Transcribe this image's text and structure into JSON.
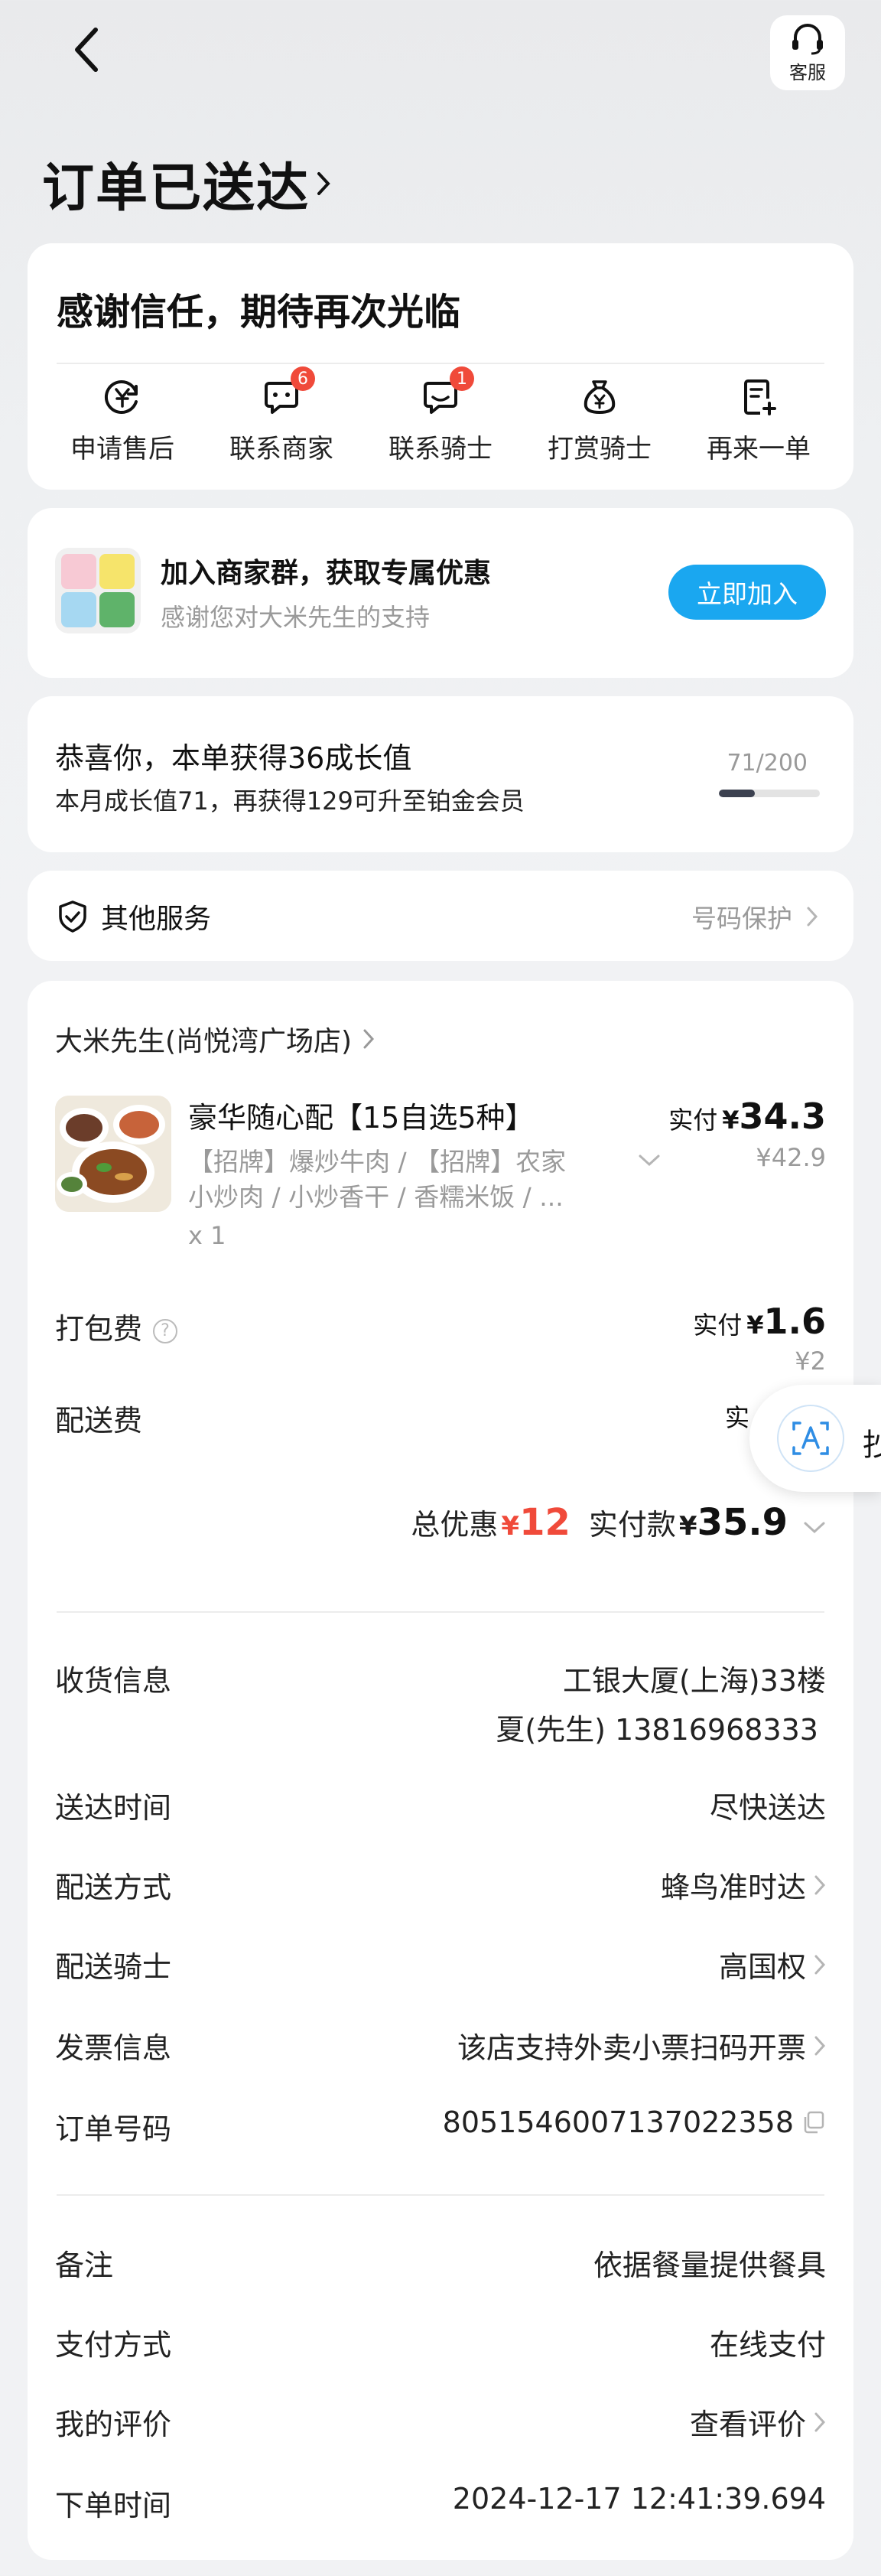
{
  "header": {
    "service_label": "客服",
    "status_title": "订单已送达"
  },
  "thanks_card": {
    "title": "感谢信任，期待再次光临",
    "actions": [
      {
        "label": "申请售后",
        "icon": "yen-circle-icon",
        "badge": ""
      },
      {
        "label": "联系商家",
        "icon": "chat-bubble-icon",
        "badge": "6"
      },
      {
        "label": "联系骑士",
        "icon": "chat-bubble-icon",
        "badge": "1"
      },
      {
        "label": "打赏骑士",
        "icon": "money-bag-icon",
        "badge": ""
      },
      {
        "label": "再来一单",
        "icon": "reorder-icon",
        "badge": ""
      }
    ]
  },
  "group_card": {
    "title": "加入商家群，获取专属优惠",
    "subtitle": "感谢您对大米先生的支持",
    "join_label": "立即加入"
  },
  "growth_card": {
    "title": "恭喜你，本单获得36成长值",
    "subtitle": "本月成长值71，再获得129可升至铂金会员",
    "progress_text": "71/200",
    "progress_fraction": 0.355
  },
  "service_card": {
    "title": "其他服务",
    "right_label": "号码保护"
  },
  "order_card": {
    "shop_name": "大米先生(尚悦湾广场店)",
    "item": {
      "title": "豪华随心配【15自选5种】",
      "spec_line1": "【招牌】爆炒牛肉 / 【招牌】农家",
      "spec_line2": "小炒肉 / 小炒香干 / 香糯米饭 / ...",
      "qty": "x 1",
      "paid_label": "实付",
      "paid_yen": "¥",
      "paid_value": "34.3",
      "original": "¥42.9"
    },
    "packing": {
      "label": "打包费",
      "paid_label": "实付",
      "paid_yen": "¥",
      "paid_value": "1.6",
      "original": "¥2"
    },
    "delivery_fee": {
      "label": "配送费",
      "paid_partial": "实"
    },
    "totals": {
      "discount_label": "总优惠",
      "discount_yen": "¥",
      "discount_value": "12",
      "paid_label": "实付款",
      "paid_yen": "¥",
      "paid_value": "35.9"
    },
    "info": [
      {
        "label": "收货信息",
        "value": "工银大厦(上海)33楼",
        "value2": "夏(先生) 13816968333"
      },
      {
        "label": "送达时间",
        "value": "尽快送达"
      },
      {
        "label": "配送方式",
        "value": "蜂鸟准时达"
      },
      {
        "label": "配送骑士",
        "value": "高国权"
      },
      {
        "label": "发票信息",
        "value": "该店支持外卖小票扫码开票"
      },
      {
        "label": "订单号码",
        "value": "8051546007137022358"
      },
      {
        "label": "备注",
        "value": "依据餐量提供餐具"
      },
      {
        "label": "支付方式",
        "value": "在线支付"
      },
      {
        "label": "我的评价",
        "value": "查看评价"
      },
      {
        "label": "下单时间",
        "value": "2024-12-17 12:41:39.694"
      }
    ]
  },
  "floating": {
    "translate_icon": "translate-icon",
    "partial_text": "抄"
  },
  "colors": {
    "accent_blue": "#1aa7f0",
    "badge_red": "#f04a3a",
    "discount_red": "#f04a3a",
    "muted_gray": "#9a9a9a"
  }
}
